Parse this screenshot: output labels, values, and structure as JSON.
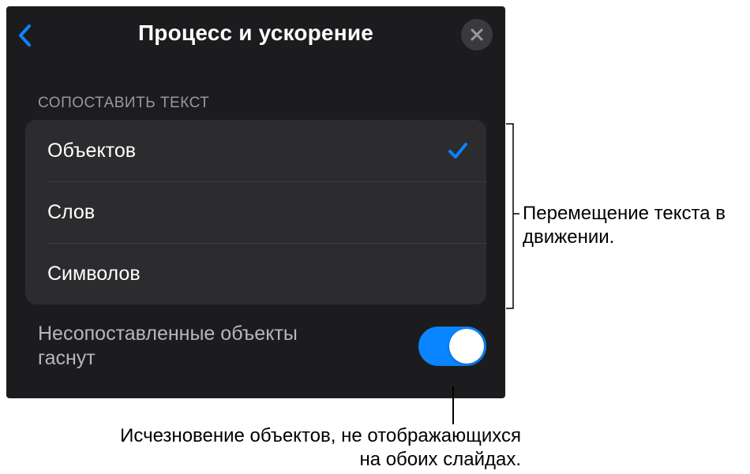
{
  "header": {
    "title": "Процесс и ускорение"
  },
  "section": {
    "header": "Сопоставить текст",
    "options": {
      "o0": "Объектов",
      "o1": "Слов",
      "o2": "Символов"
    },
    "selectedIndex": 0
  },
  "toggle": {
    "label": "Несопоставленные объекты гаснут",
    "on": true
  },
  "callouts": {
    "c1": "Перемещение текста в движении.",
    "c2": "Исчезновение объектов, не отображающихся на обоих слайдах."
  },
  "colors": {
    "accent": "#0a84ff",
    "panelBg": "#1c1c1e",
    "listBg": "#2c2c2e"
  }
}
